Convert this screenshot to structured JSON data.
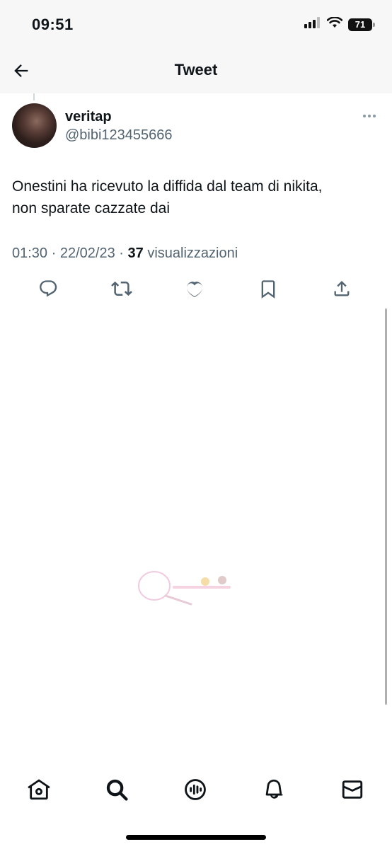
{
  "status_bar": {
    "time": "09:51",
    "battery": "71",
    "icons": [
      "signal-icon",
      "wifi-icon",
      "battery-icon"
    ]
  },
  "header": {
    "title": "Tweet",
    "back_icon": "arrow-left-icon"
  },
  "tweet": {
    "display_name": "veritap",
    "handle": "@bibi123455666",
    "text_line1": "Onestini ha ricevuto la diffida dal team di nikita,",
    "text_line2": "non sparate cazzate dai",
    "time": "01:30",
    "separator": "·",
    "date": "22/02/23",
    "views_count": "37",
    "views_label": "visualizzazioni"
  },
  "actions": [
    "reply-icon",
    "retweet-icon",
    "like-icon",
    "bookmark-icon",
    "share-icon"
  ],
  "tab_bar": [
    "home-icon",
    "search-icon",
    "spaces-icon",
    "notifications-icon",
    "messages-icon"
  ],
  "colors": {
    "text": "#0f1419",
    "secondary": "#536471",
    "header_bg": "#f7f7f7"
  }
}
